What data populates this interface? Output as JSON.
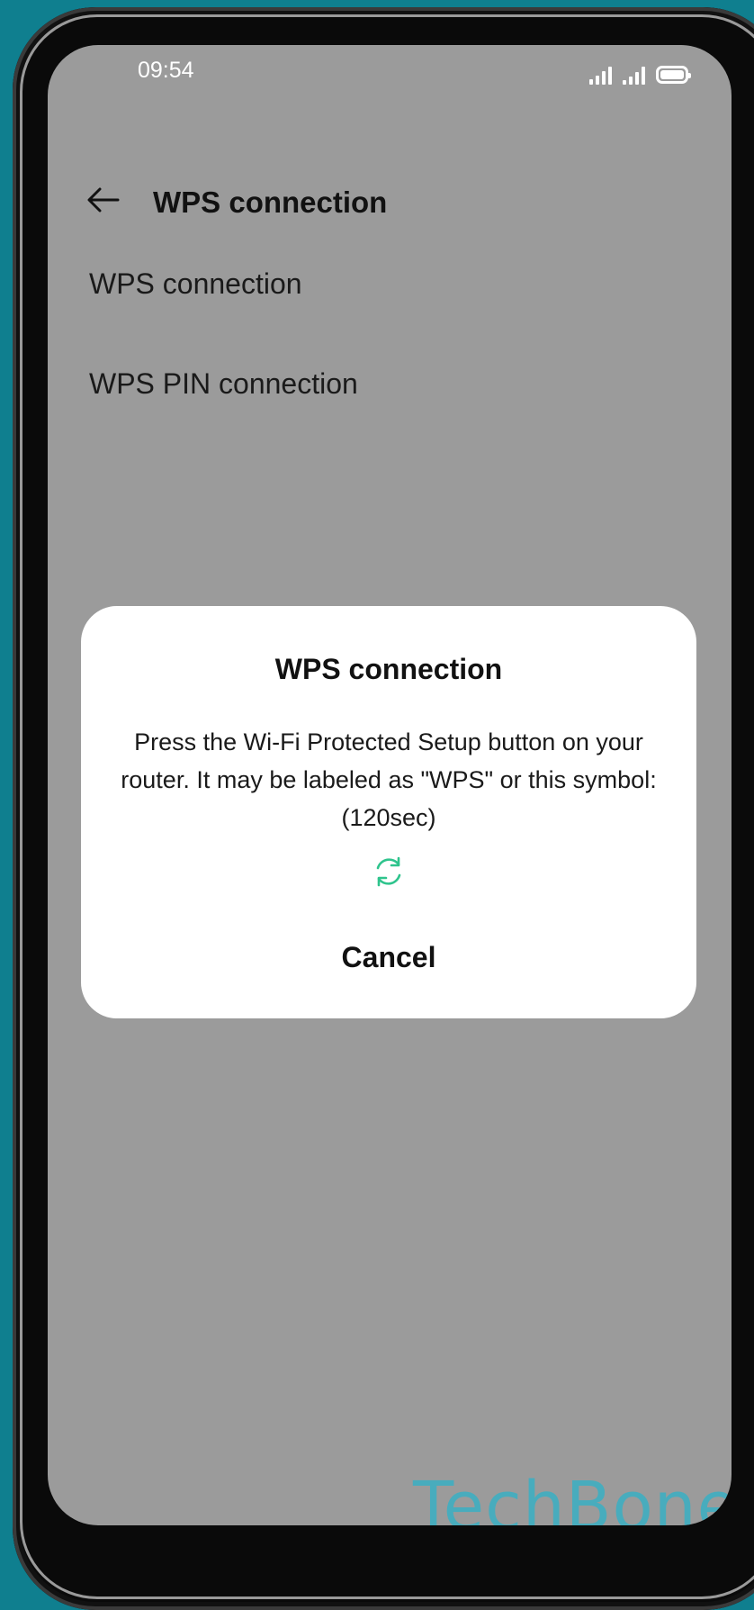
{
  "status_bar": {
    "time": "09:54",
    "icons": [
      "signal-sim1-icon",
      "signal-sim2-icon",
      "battery-icon"
    ]
  },
  "app_bar": {
    "back_icon": "arrow-left-icon",
    "title": "WPS connection"
  },
  "menu": {
    "items": [
      {
        "label": "WPS connection"
      },
      {
        "label": "WPS PIN connection"
      }
    ]
  },
  "dialog": {
    "title": "WPS connection",
    "message": "Press the Wi-Fi Protected Setup button on your router. It may be labeled as \"WPS\" or this symbol: (120sec)",
    "spinner_icon": "refresh-icon",
    "cancel_label": "Cancel",
    "accent_color": "#2fc48d"
  },
  "watermark": {
    "text": "TechBone",
    "color": "#3ab0c4"
  },
  "colors": {
    "background": "#0f7f8f",
    "screen_dim": "#9b9b9b",
    "dialog": "#ffffff"
  }
}
